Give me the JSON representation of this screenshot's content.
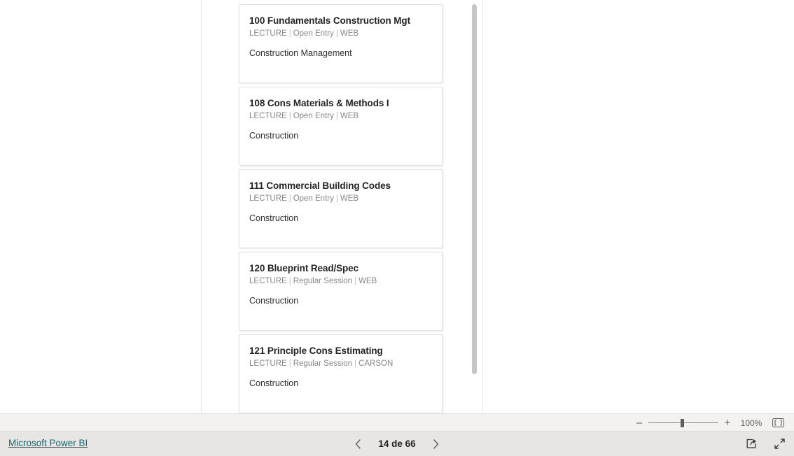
{
  "visual": {
    "name": "course-card-list",
    "cards": [
      {
        "title": "100 Fundamentals Construction Mgt",
        "type": "LECTURE",
        "session": "Open Entry",
        "location": "WEB",
        "department": "Construction Management"
      },
      {
        "title": "108 Cons Materials & Methods I",
        "type": "LECTURE",
        "session": "Open Entry",
        "location": "WEB",
        "department": "Construction"
      },
      {
        "title": "111 Commercial Building Codes",
        "type": "LECTURE",
        "session": "Open Entry",
        "location": "WEB",
        "department": "Construction"
      },
      {
        "title": "120 Blueprint Read/Spec",
        "type": "LECTURE",
        "session": "Regular Session",
        "location": "WEB",
        "department": "Construction"
      },
      {
        "title": "121 Principle Cons Estimating",
        "type": "LECTURE",
        "session": "Regular Session",
        "location": "CARSON",
        "department": "Construction"
      }
    ],
    "separator": "|"
  },
  "zoom_toolbar": {
    "minus_label": "–",
    "plus_label": "+",
    "percent": "100%",
    "fit_icon": "fit-to-page-icon"
  },
  "footer": {
    "brand_link": "Microsoft Power BI",
    "prev_icon": "chevron-left-icon",
    "next_icon": "chevron-right-icon",
    "page_label": "14 de 66",
    "share_icon": "share-icon",
    "fullscreen_icon": "fullscreen-icon"
  },
  "colors": {
    "link": "#0f6a6f",
    "card_title": "#252423",
    "card_meta": "#8a8886",
    "footer_bg": "#e7e6e5",
    "toolbar_bg": "#f3f2f1"
  }
}
